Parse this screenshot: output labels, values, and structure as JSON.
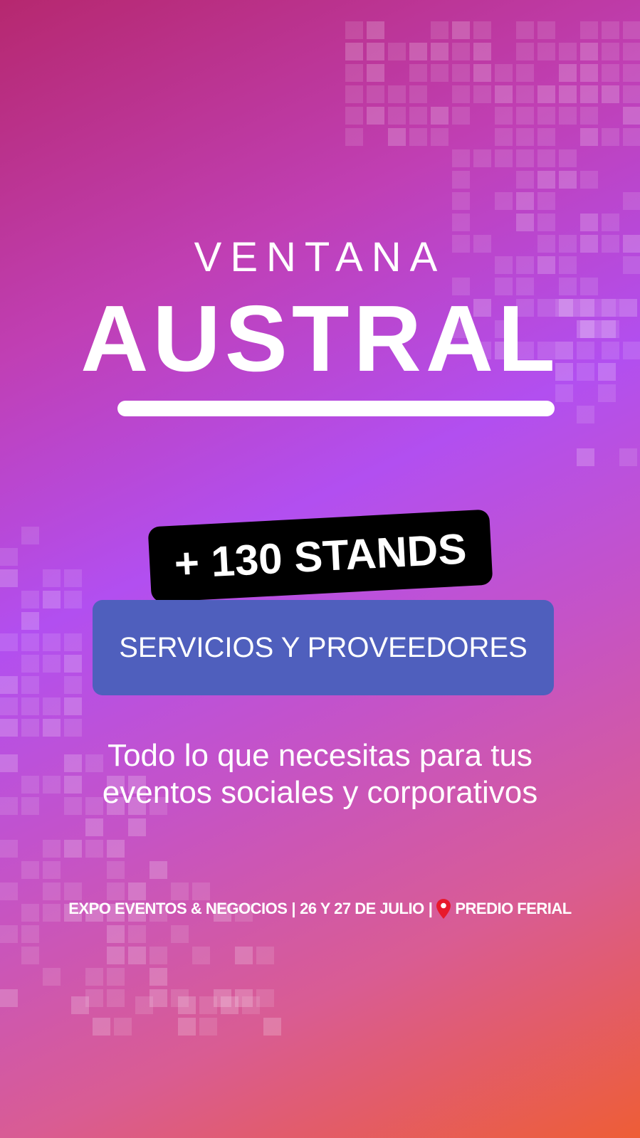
{
  "brand": {
    "line1": "VENTANA",
    "line2": "AUSTRAL"
  },
  "badge": {
    "stands": "+ 130 STANDS"
  },
  "services": {
    "label": "SERVICIOS Y PROVEEDORES"
  },
  "tagline": {
    "line1": "Todo lo que necesitas para tus",
    "line2": "eventos sociales y corporativos"
  },
  "footer": {
    "event": "EXPO EVENTOS & NEGOCIOS",
    "separator1": "|",
    "dates": "26 Y 27 DE JULIO",
    "separator2": "|",
    "pin_icon": "location-pin-icon",
    "venue": "PREDIO FERIAL"
  },
  "colors": {
    "badge_bg": "#000000",
    "services_bg": "#4f5fbd",
    "pin": "#e8192c"
  }
}
